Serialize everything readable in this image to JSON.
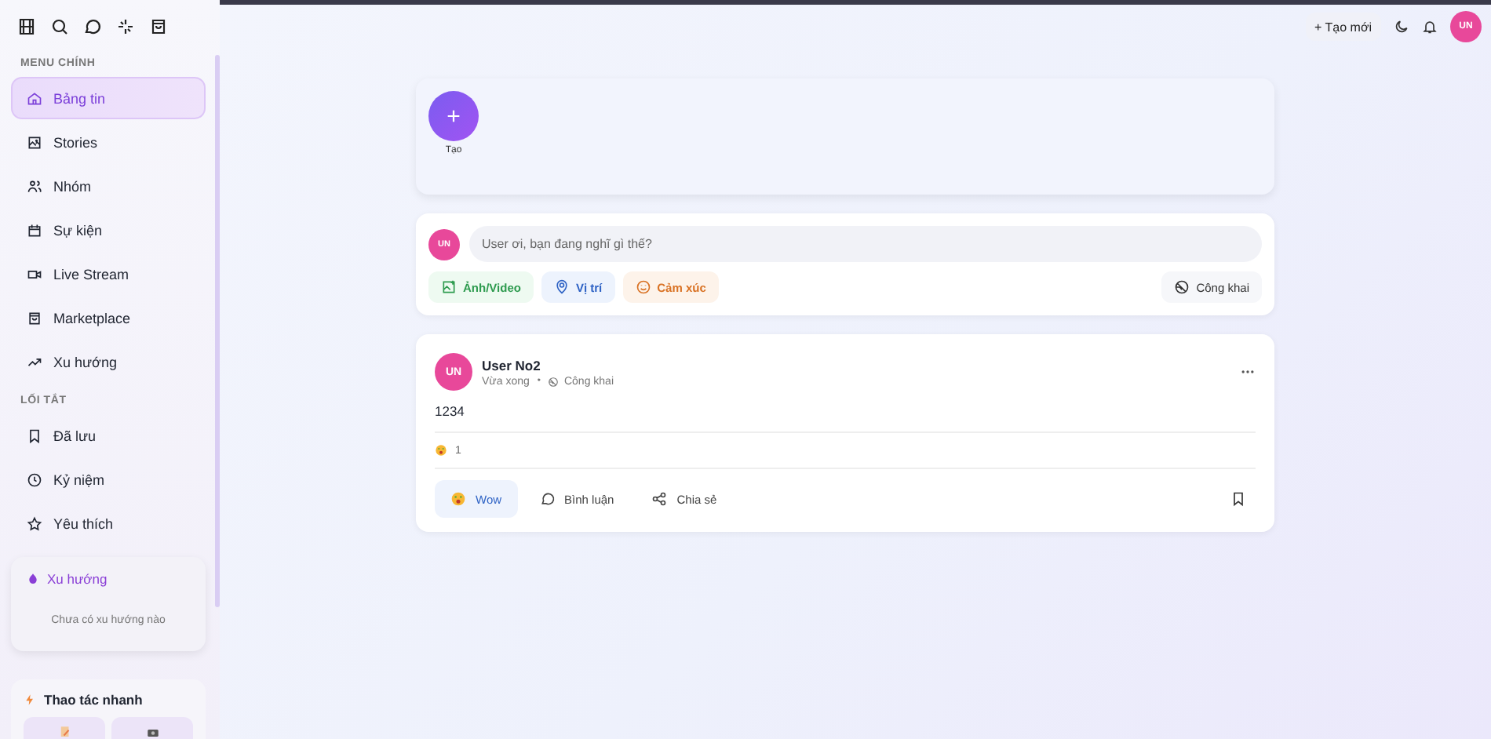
{
  "sidebar": {
    "sections": [
      {
        "title": "MENU CHÍNH",
        "items": [
          {
            "label": "Bảng tin",
            "selected": true
          },
          {
            "label": "Stories",
            "selected": false
          },
          {
            "label": "Nhóm",
            "selected": false
          },
          {
            "label": "Sự kiện",
            "selected": false
          },
          {
            "label": "Live Stream",
            "selected": false
          },
          {
            "label": "Marketplace",
            "selected": false
          },
          {
            "label": "Xu hướng",
            "selected": false
          }
        ]
      },
      {
        "title": "LỐI TẮT",
        "items": [
          {
            "label": "Đã lưu",
            "selected": false
          },
          {
            "label": "Kỷ niệm",
            "selected": false
          },
          {
            "label": "Yêu thích",
            "selected": false
          }
        ]
      }
    ],
    "trending": {
      "title": "Xu hướng",
      "empty": "Chưa có xu hướng nào"
    },
    "quick": {
      "title": "Thao tác nhanh"
    }
  },
  "header": {
    "create": "+ Tạo mới",
    "avatar": "UN"
  },
  "stories": {
    "create_label": "Tạo",
    "create_symbol": "+"
  },
  "composer": {
    "avatar": "UN",
    "placeholder": "User ơi, bạn đang nghĩ gì thế?",
    "actions": [
      {
        "label": "Ảnh/Video",
        "kind": "photo"
      },
      {
        "label": "Vị trí",
        "kind": "location"
      },
      {
        "label": "Cảm xúc",
        "kind": "feeling"
      }
    ],
    "privacy": "Công khai"
  },
  "post": {
    "avatar": "UN",
    "author": "User No2",
    "time": "Vừa xong",
    "separator": "•",
    "privacy": "Công khai",
    "body": "1234",
    "reaction_count": "1",
    "actions": [
      {
        "label": "Wow",
        "kind": "reaction",
        "selected": true
      },
      {
        "label": "Bình luận",
        "kind": "comment",
        "selected": false
      },
      {
        "label": "Chia sẻ",
        "kind": "share",
        "selected": false
      }
    ]
  }
}
